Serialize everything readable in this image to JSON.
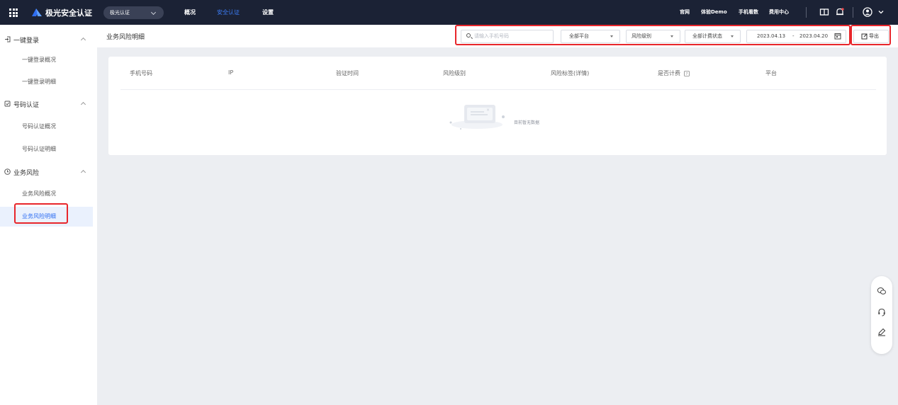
{
  "topbar": {
    "app_title": "极光安全认证",
    "product_select": "极光认证",
    "nav": [
      {
        "label": "概况"
      },
      {
        "label": "安全认证"
      },
      {
        "label": "设置"
      }
    ],
    "links": [
      {
        "label": "官网"
      },
      {
        "label": "体验Demo"
      },
      {
        "label": "手机看数"
      },
      {
        "label": "费用中心"
      }
    ]
  },
  "sidebar": {
    "groups": [
      {
        "label": "一键登录",
        "items": [
          "一键登录概况",
          "一键登录明细"
        ]
      },
      {
        "label": "号码认证",
        "items": [
          "号码认证概况",
          "号码认证明细"
        ]
      },
      {
        "label": "业务风险",
        "items": [
          "业务风险概况",
          "业务风险明细"
        ]
      }
    ],
    "active_item": "业务风险明细"
  },
  "header": {
    "title": "业务风险明细",
    "search_placeholder": "请输入手机号码",
    "platform": "全部平台",
    "risk_level": "风险级别",
    "billing_status": "全部计费状态",
    "date_start": "2023.04.13",
    "date_sep": "-",
    "date_end": "2023.04.20",
    "export_label": "导出"
  },
  "table": {
    "columns": [
      "手机号码",
      "IP",
      "验证时间",
      "风险级别",
      "风险标签(详情)",
      "是否计费",
      "平台"
    ],
    "rows": [],
    "empty_text": "目前暂无数据"
  },
  "colors": {
    "topbar_bg": "#1b2235",
    "accent": "#2f6ef2",
    "highlight": "#e8262b"
  }
}
